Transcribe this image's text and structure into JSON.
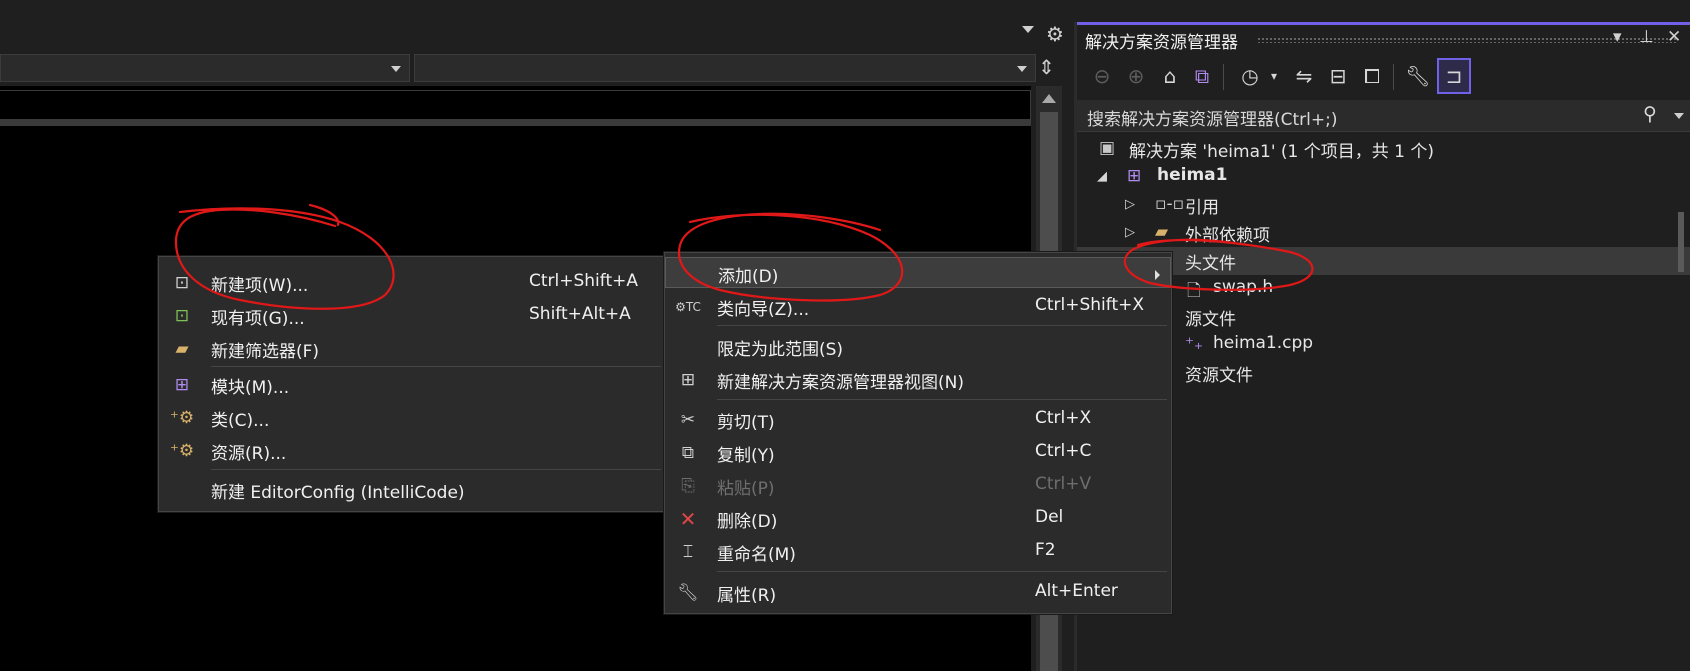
{
  "solution_explorer": {
    "title": "解决方案资源管理器",
    "title_controls": [
      "▾",
      "⊥",
      "✕"
    ],
    "search_placeholder": "搜索解决方案资源管理器(Ctrl+;)",
    "toolbar_icons": [
      "back-icon",
      "forward-icon",
      "home-icon",
      "vs-solution-icon",
      "history-icon",
      "history-dropdown-icon",
      "sync-icon",
      "collapse-all-icon",
      "show-all-files-icon",
      "properties-icon",
      "preview-selected-icon"
    ],
    "tree": [
      {
        "label": "解决方案 'heima1' (1 个项目，共 1 个)",
        "icon": "solution-icon",
        "expander": ""
      },
      {
        "label": "heima1",
        "icon": "cpp-project-icon",
        "expander": "◢",
        "bold": true
      },
      {
        "label": "引用",
        "icon": "references-icon",
        "expander": "▷"
      },
      {
        "label": "外部依赖项",
        "icon": "folder-icon",
        "expander": "▷"
      },
      {
        "label": "头文件",
        "icon": "filter-folder-icon",
        "expander": "◢",
        "selected": true
      },
      {
        "label": "swap.h",
        "icon": "header-file-icon",
        "expander": ""
      },
      {
        "label": "源文件",
        "icon": "filter-folder-icon",
        "expander": "◢"
      },
      {
        "label": "heima1.cpp",
        "icon": "cpp-file-icon",
        "expander": ""
      },
      {
        "label": "资源文件",
        "icon": "filter-folder-icon",
        "expander": ""
      }
    ]
  },
  "context_menu": {
    "items": [
      {
        "label": "添加(D)",
        "shortcut": "",
        "icon": "",
        "submenu": true,
        "highlighted": true
      },
      {
        "label": "类向导(Z)...",
        "shortcut": "Ctrl+Shift+X",
        "icon": "class-wizard-icon"
      },
      {
        "label": "限定为此范围(S)",
        "shortcut": "",
        "icon": ""
      },
      {
        "label": "新建解决方案资源管理器视图(N)",
        "shortcut": "",
        "icon": "new-view-icon"
      },
      {
        "label": "剪切(T)",
        "shortcut": "Ctrl+X",
        "icon": "cut-icon"
      },
      {
        "label": "复制(Y)",
        "shortcut": "Ctrl+C",
        "icon": "copy-icon"
      },
      {
        "label": "粘贴(P)",
        "shortcut": "Ctrl+V",
        "icon": "paste-icon",
        "disabled": true
      },
      {
        "label": "删除(D)",
        "shortcut": "Del",
        "icon": "delete-icon"
      },
      {
        "label": "重命名(M)",
        "shortcut": "F2",
        "icon": "rename-icon"
      },
      {
        "label": "属性(R)",
        "shortcut": "Alt+Enter",
        "icon": "properties-icon"
      }
    ]
  },
  "add_submenu": {
    "items": [
      {
        "label": "新建项(W)...",
        "shortcut": "Ctrl+Shift+A",
        "icon": "new-item-icon"
      },
      {
        "label": "现有项(G)...",
        "shortcut": "Shift+Alt+A",
        "icon": "existing-item-icon"
      },
      {
        "label": "新建筛选器(F)",
        "shortcut": "",
        "icon": "new-filter-icon"
      },
      {
        "label": "模块(M)...",
        "shortcut": "",
        "icon": "module-icon"
      },
      {
        "label": "类(C)...",
        "shortcut": "",
        "icon": "class-icon"
      },
      {
        "label": "资源(R)...",
        "shortcut": "",
        "icon": "resource-icon"
      },
      {
        "label": "新建 EditorConfig (IntelliCode)",
        "shortcut": "",
        "icon": ""
      }
    ]
  },
  "colors": {
    "accent": "#7160e8",
    "annotation_red": "#e01818",
    "menu_bg": "#2b2b2b",
    "delete_icon": "#e04646",
    "add_icon_green": "#7fc255"
  }
}
